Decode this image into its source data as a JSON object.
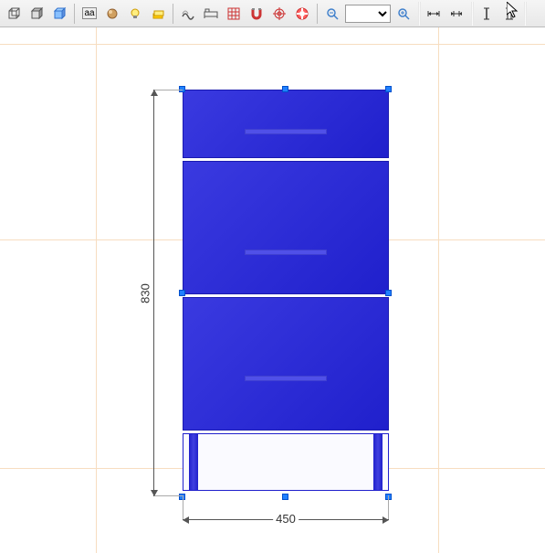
{
  "toolbar": {
    "zoom_value": ""
  },
  "dimensions": {
    "height": "830",
    "width": "450"
  },
  "cabinet": {
    "color": "#2a2ad5",
    "drawers": 3
  },
  "selection": {
    "active": true,
    "handle_color": "#2080ff"
  },
  "icons": {
    "cube_wire": "cube-wireframe",
    "cube_face": "cube-face",
    "cube_solid": "cube-solid",
    "text": "aa",
    "sphere": "sphere",
    "bulb": "lightbulb",
    "layers": "layers",
    "wave": "wave",
    "bed": "bed",
    "grid": "grid",
    "magnet": "magnet",
    "target": "target",
    "lifebuoy": "lifebuoy",
    "zoom_out": "zoom-out",
    "zoom_in": "zoom-in",
    "dim_h": "dimension-horizontal",
    "dim_h2": "dimension-horizontal-alt",
    "text_cursor": "text-cursor",
    "text_height": "text-height"
  }
}
